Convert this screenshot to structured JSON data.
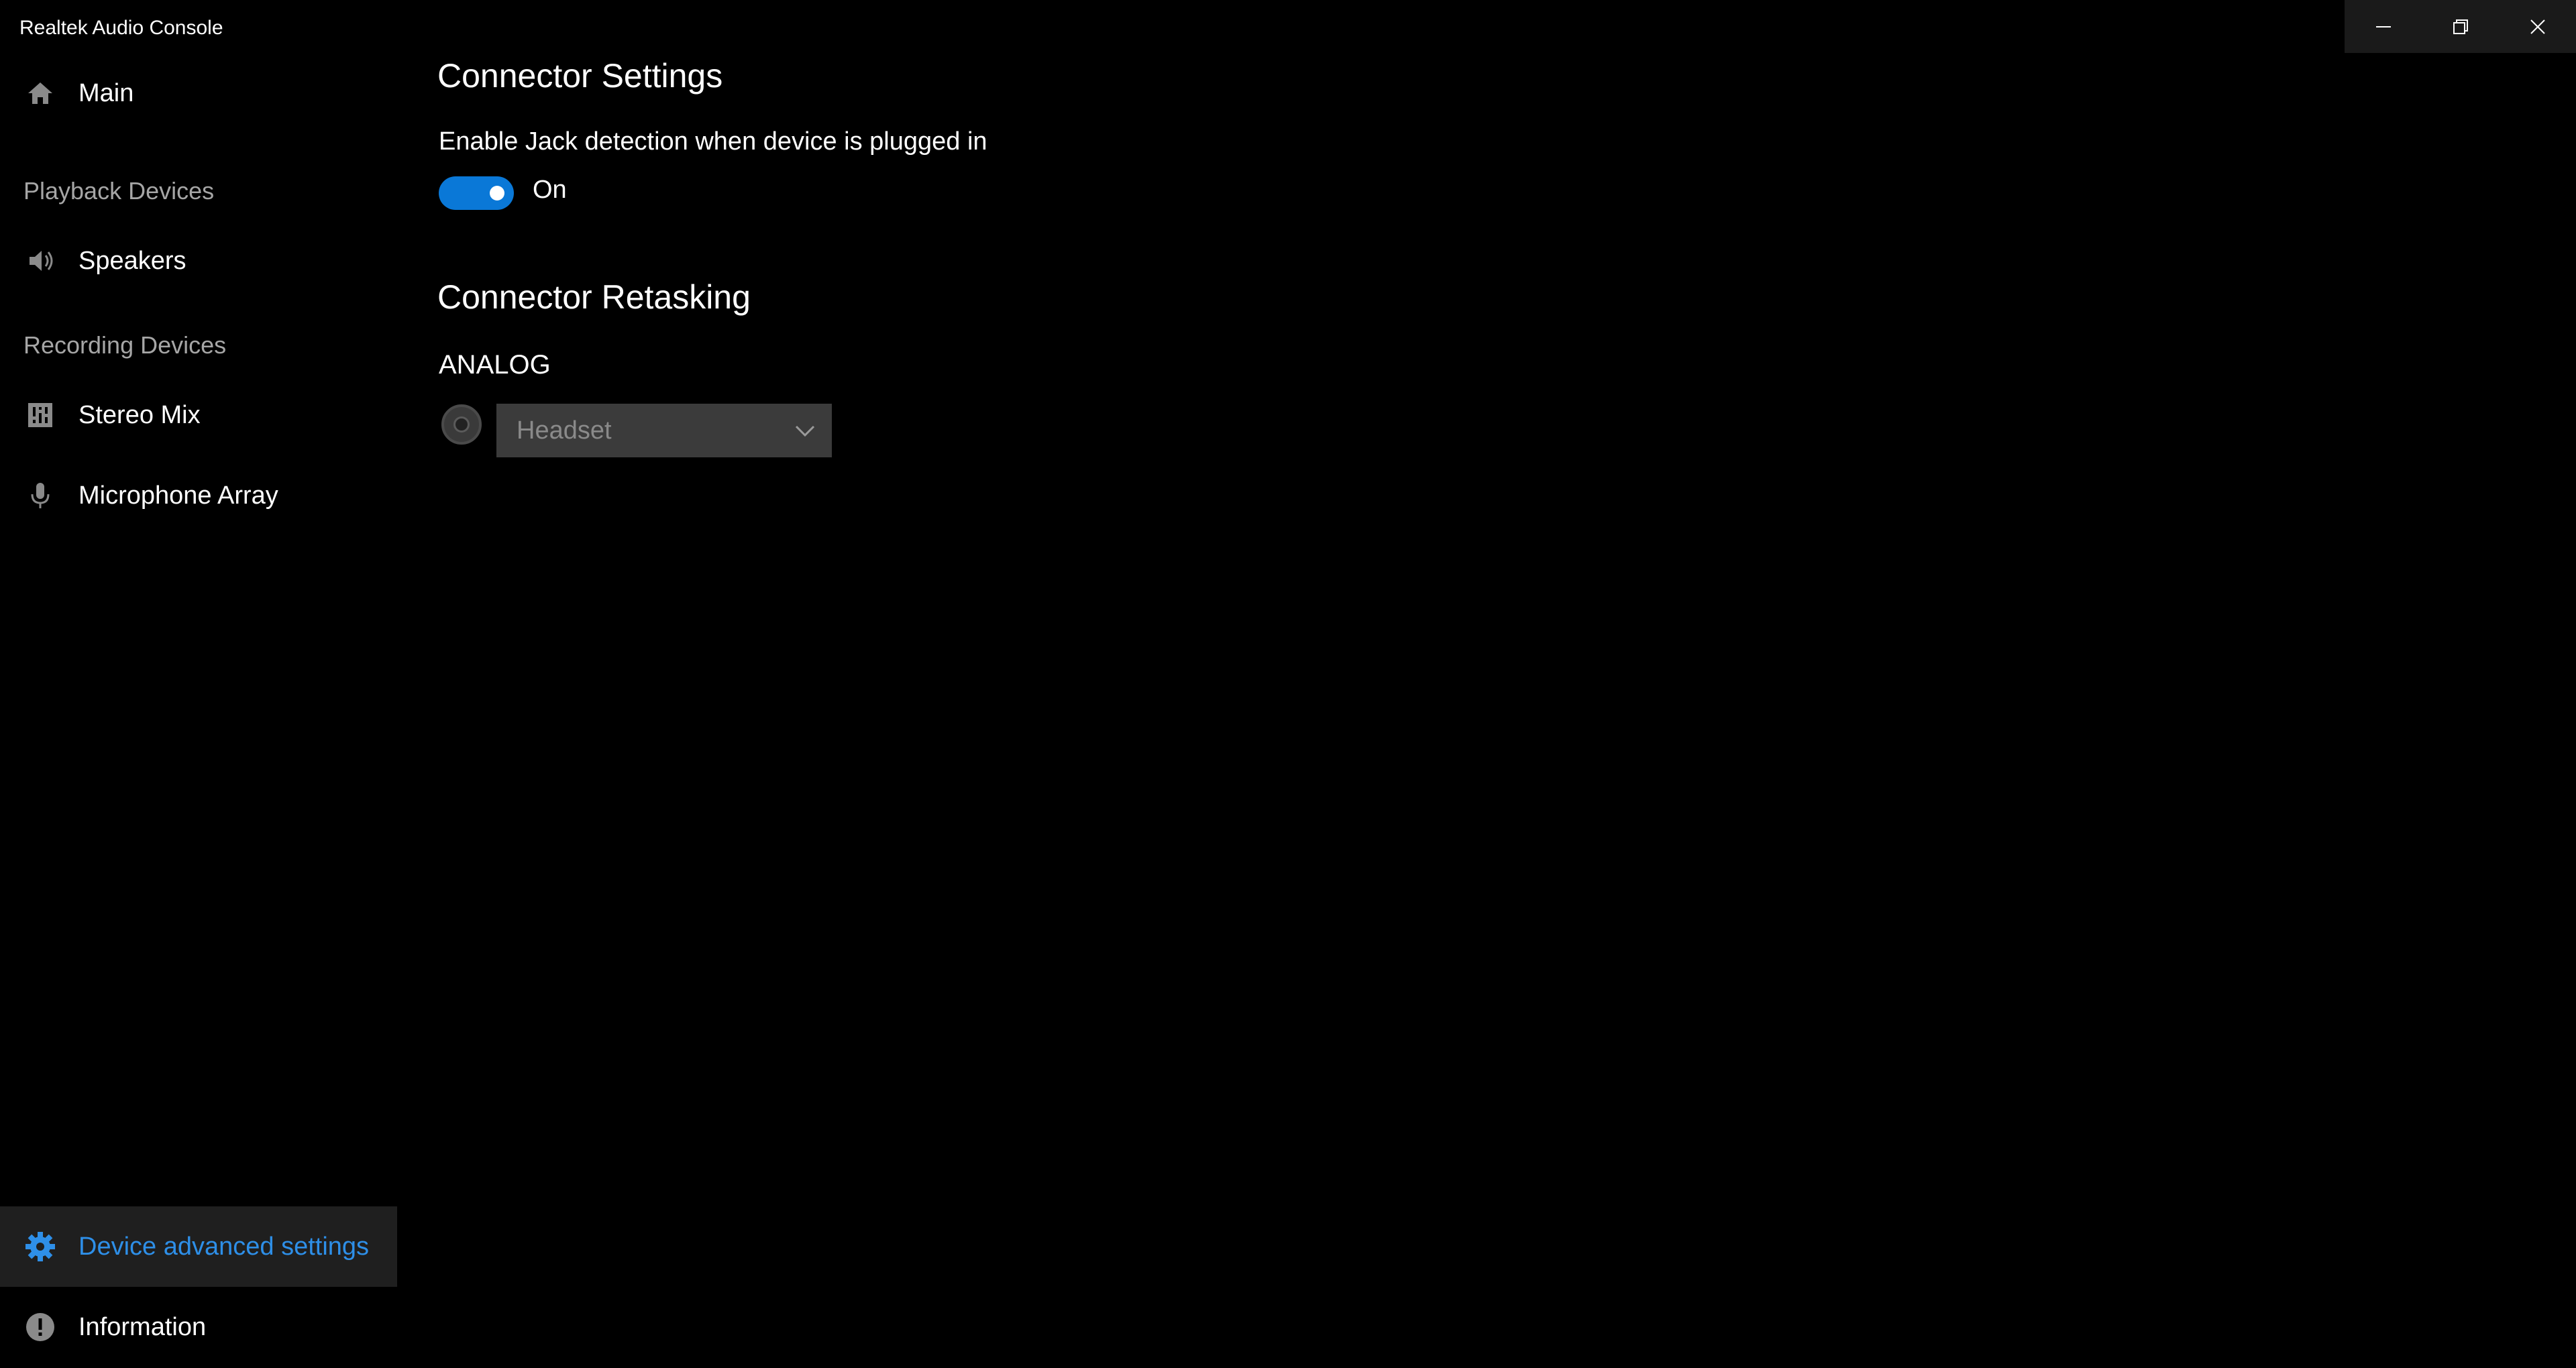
{
  "window": {
    "title": "Realtek Audio Console"
  },
  "sidebar": {
    "main_label": "Main",
    "playback_section": "Playback Devices",
    "speakers_label": "Speakers",
    "recording_section": "Recording Devices",
    "stereo_mix_label": "Stereo Mix",
    "microphone_label": "Microphone Array",
    "advanced_label": "Device advanced settings",
    "information_label": "Information"
  },
  "main": {
    "connector_settings_title": "Connector Settings",
    "jack_detection_label": "Enable Jack detection when device is plugged in",
    "jack_detection_state": "On",
    "connector_retasking_title": "Connector Retasking",
    "analog_label": "ANALOG",
    "analog_device_selected": "Headset"
  },
  "colors": {
    "accent": "#0a78d7",
    "active_text": "#2e8fe8",
    "section_text": "#a6a6a6",
    "background": "#000000"
  },
  "icons": {
    "main": "home-icon",
    "speakers": "speaker-icon",
    "stereo_mix": "equalizer-icon",
    "microphone": "microphone-icon",
    "advanced": "gear-icon",
    "information": "info-icon",
    "jack": "audio-jack-icon",
    "dropdown": "chevron-down-icon"
  }
}
